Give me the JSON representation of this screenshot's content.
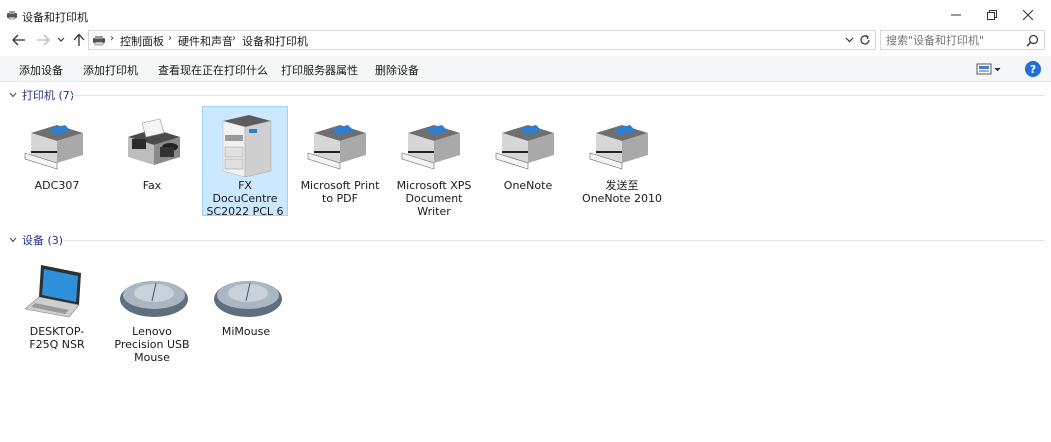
{
  "window": {
    "title": "设备和打印机",
    "minimize": "minimize",
    "maximize": "maximize",
    "close": "close"
  },
  "address": {
    "breadcrumbs": [
      "控制面板",
      "硬件和声音",
      "设备和打印机"
    ]
  },
  "search": {
    "placeholder": "搜索\"设备和打印机\""
  },
  "toolbar": {
    "commands": [
      "添加设备",
      "添加打印机",
      "查看现在正在打印什么",
      "打印服务器属性",
      "删除设备"
    ],
    "help_label": "?"
  },
  "groups": [
    {
      "label": "打印机 (7)",
      "items": [
        {
          "label": "ADC307",
          "icon": "printer-icon",
          "selected": false
        },
        {
          "label": "Fax",
          "icon": "fax-icon",
          "selected": false
        },
        {
          "label": "FX DocuCentre SC2022 PCL 6",
          "icon": "copier-icon",
          "selected": true
        },
        {
          "label": "Microsoft Print to PDF",
          "icon": "printer-icon",
          "selected": false
        },
        {
          "label": "Microsoft XPS Document Writer",
          "icon": "printer-icon",
          "selected": false
        },
        {
          "label": "OneNote",
          "icon": "printer-icon",
          "selected": false
        },
        {
          "label": "发送至 OneNote 2010",
          "icon": "printer-icon",
          "selected": false
        }
      ]
    },
    {
      "label": "设备 (3)",
      "items": [
        {
          "label": "DESKTOP-F25Q NSR",
          "icon": "laptop-icon",
          "selected": false
        },
        {
          "label": "Lenovo Precision USB Mouse",
          "icon": "mouse-icon",
          "selected": false
        },
        {
          "label": "MiMouse",
          "icon": "mouse-icon",
          "selected": false
        }
      ]
    }
  ],
  "colors": {
    "accent": "#1e6fd9",
    "group_header": "#1e3287",
    "selection_bg": "#cce8ff",
    "selection_border": "#99d1ff"
  }
}
